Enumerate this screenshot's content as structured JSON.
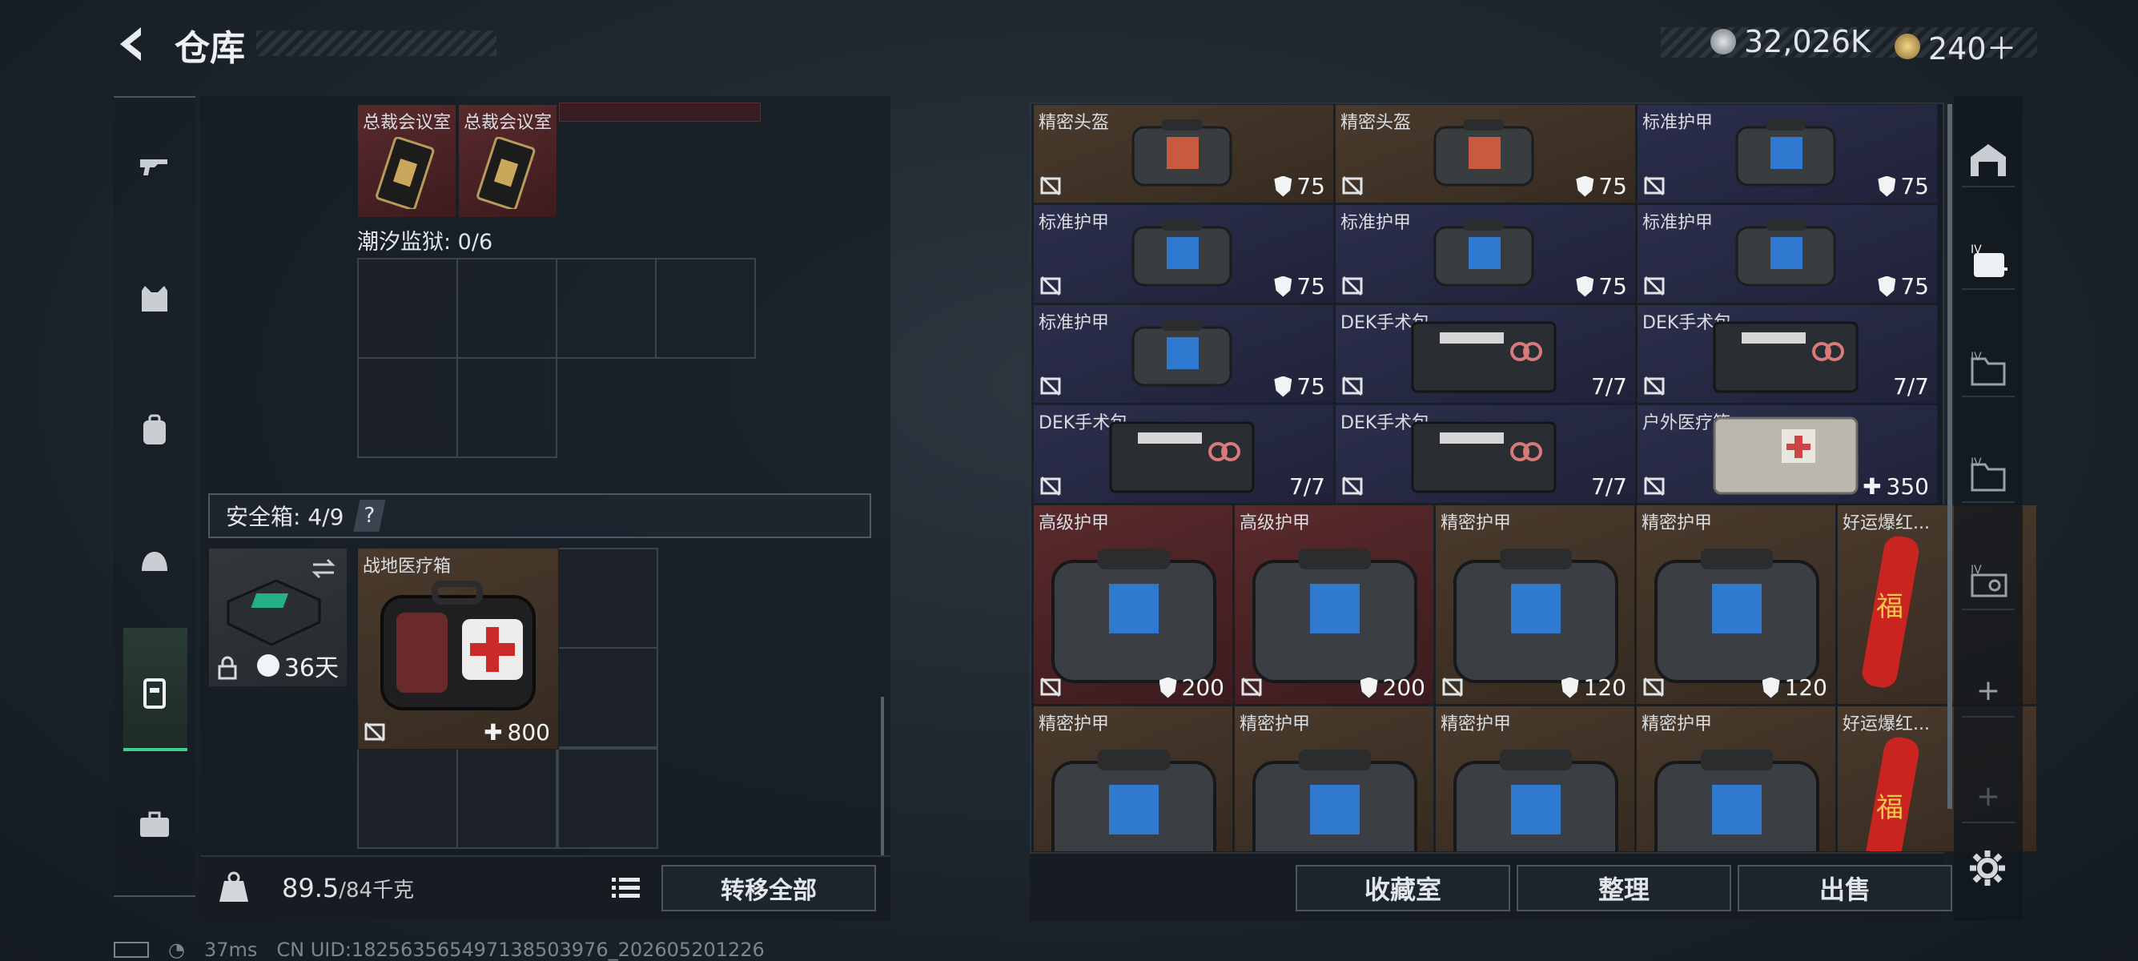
{
  "header": {
    "title": "仓库"
  },
  "currency": [
    {
      "icon": "silver-coin-icon",
      "value": "32,026K",
      "color": "#c9ced3"
    },
    {
      "icon": "gold-coin-icon",
      "value": "240＋",
      "color": "#d7b46a"
    }
  ],
  "sidebar": {
    "items": [
      "gun-icon",
      "armor-vest-icon",
      "backpack-icon",
      "helmet-bag-icon",
      "safebox-icon",
      "briefcase-icon"
    ],
    "active": 4
  },
  "left": {
    "keycards": [
      {
        "label": "总裁会议室"
      },
      {
        "label": "总裁会议室"
      }
    ],
    "prison_label": "潮汐监狱: 0/6",
    "safebox_label": "安全箱: 4/9",
    "safebox_help": "?",
    "safebox_timer": "36天",
    "medkit": {
      "label": "战地医疗箱",
      "value": "800"
    }
  },
  "weight": {
    "current": "89.5",
    "max": "/84千克"
  },
  "transfer_label": "转移全部",
  "right_items": [
    {
      "label": "精密头盔",
      "value": "75",
      "type": "shield",
      "color": "brown",
      "kind": "helmet"
    },
    {
      "label": "精密头盔",
      "value": "75",
      "type": "shield",
      "color": "brown",
      "kind": "helmet"
    },
    {
      "label": "标准护甲",
      "value": "75",
      "type": "shield",
      "color": "navy",
      "kind": "vest"
    },
    {
      "label": "标准护甲",
      "value": "75",
      "type": "shield",
      "color": "navy",
      "kind": "vest"
    },
    {
      "label": "标准护甲",
      "value": "75",
      "type": "shield",
      "color": "navy",
      "kind": "vest"
    },
    {
      "label": "标准护甲",
      "value": "75",
      "type": "shield",
      "color": "navy",
      "kind": "vest"
    },
    {
      "label": "标准护甲",
      "value": "75",
      "type": "shield",
      "color": "navy",
      "kind": "vest"
    },
    {
      "label": "DEK手术包",
      "value": "7/7",
      "type": "none",
      "color": "navy",
      "kind": "kit"
    },
    {
      "label": "DEK手术包",
      "value": "7/7",
      "type": "none",
      "color": "navy",
      "kind": "kit"
    },
    {
      "label": "DEK手术包",
      "value": "7/7",
      "type": "none",
      "color": "navy",
      "kind": "kit"
    },
    {
      "label": "DEK手术包",
      "value": "7/7",
      "type": "none",
      "color": "navy",
      "kind": "kit"
    },
    {
      "label": "户外医疗箱",
      "value": "350",
      "type": "plus",
      "color": "navy",
      "kind": "medbox"
    },
    {
      "label": "高级护甲",
      "value": "200",
      "type": "shield",
      "color": "red",
      "kind": "bigvest"
    },
    {
      "label": "高级护甲",
      "value": "200",
      "type": "shield",
      "color": "red",
      "kind": "bigvest"
    },
    {
      "label": "精密护甲",
      "value": "120",
      "type": "shield",
      "color": "brown",
      "kind": "bigvest"
    },
    {
      "label": "精密护甲",
      "value": "120",
      "type": "shield",
      "color": "brown",
      "kind": "bigvest"
    },
    {
      "label": "好运爆红...",
      "value": "",
      "type": "none",
      "color": "brown",
      "kind": "firecracker"
    },
    {
      "label": "精密护甲",
      "value": "",
      "type": "none",
      "color": "brown",
      "kind": "bigvest"
    },
    {
      "label": "精密护甲",
      "value": "",
      "type": "none",
      "color": "brown",
      "kind": "bigvest"
    },
    {
      "label": "精密护甲",
      "value": "",
      "type": "none",
      "color": "brown",
      "kind": "bigvest"
    },
    {
      "label": "精密护甲",
      "value": "",
      "type": "none",
      "color": "brown",
      "kind": "bigvest"
    },
    {
      "label": "好运爆红...",
      "value": "",
      "type": "none",
      "color": "brown",
      "kind": "firecracker"
    }
  ],
  "right_sidebar": [
    "warehouse-icon",
    "medkit-iv-icon",
    "folder-iv-icon",
    "folder-iv-icon",
    "ticket-iv-icon",
    "add-icon",
    "add-icon"
  ],
  "buttons": {
    "collection": "收藏室",
    "organize": "整理",
    "sell": "出售"
  },
  "status": {
    "ping": "37ms",
    "uid": "CN UID:18256356549713850​3976_202605201226"
  }
}
